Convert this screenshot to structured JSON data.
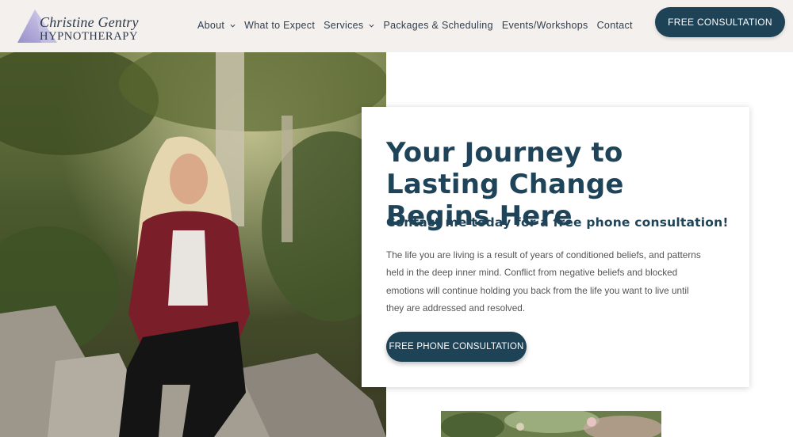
{
  "brand": {
    "script_name": "Christine Gentry",
    "caps_name": "HYPNOTHERAPY",
    "logo_icon": "triangle-logo-icon",
    "colors": {
      "triangle": "#a9a3d4",
      "text": "#2c3a4a"
    }
  },
  "nav": {
    "items": [
      {
        "label": "About",
        "has_dropdown": true
      },
      {
        "label": "What to Expect",
        "has_dropdown": false
      },
      {
        "label": "Services",
        "has_dropdown": true
      },
      {
        "label": "Packages & Scheduling",
        "has_dropdown": false
      },
      {
        "label": "Events/Workshops",
        "has_dropdown": false
      },
      {
        "label": "Contact",
        "has_dropdown": false
      }
    ],
    "cta_label": "FREE CONSULTATION"
  },
  "hero": {
    "headline": "Your Journey to Lasting Change Begins Here",
    "subheadline": "Contact me today for a free phone consultation!",
    "body": "The life you are living is a result of years of conditioned beliefs, and patterns held in the deep inner mind. Conflict from negative beliefs and blocked emotions will continue holding you back from the life you want to live until they are addressed and resolved.",
    "cta_label": "FREE PHONE CONSULTATION"
  },
  "colors": {
    "header_bg": "#f3f0ee",
    "primary": "#1e4256",
    "heading": "#1f4459",
    "body_text": "#555555"
  }
}
